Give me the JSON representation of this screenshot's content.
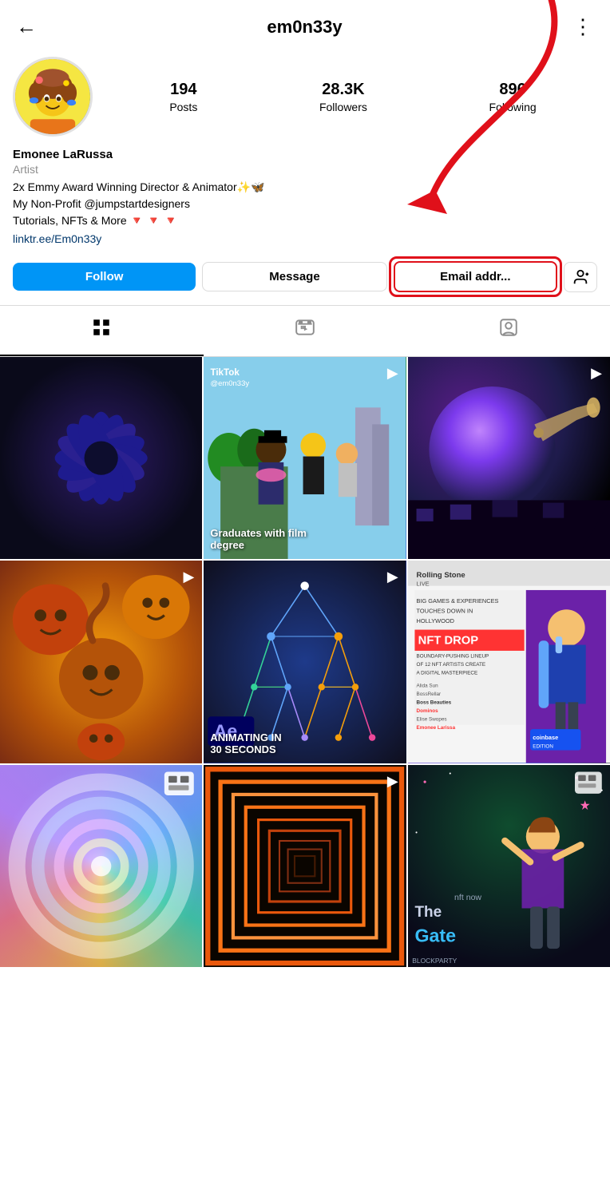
{
  "header": {
    "back_icon": "←",
    "username": "em0n33y",
    "more_icon": "⋮"
  },
  "profile": {
    "stats": {
      "posts_count": "194",
      "posts_label": "Posts",
      "followers_count": "28.3K",
      "followers_label": "Followers",
      "following_count": "896",
      "following_label": "Following"
    },
    "name": "Emonee LaRussa",
    "category": "Artist",
    "bio_line1": "2x Emmy Award Winning Director & Animator✨🦋",
    "bio_line2": "My Non-Profit @jumpstartdesigners",
    "bio_line3": "Tutorials, NFTs & More 🔻 🔻 🔻",
    "link": "linktr.ee/Em0n33y"
  },
  "buttons": {
    "follow": "Follow",
    "message": "Message",
    "email": "Email addr...",
    "person_icon": "👤"
  },
  "tabs": {
    "grid_icon": "▦",
    "reels_icon": "📺",
    "tagged_icon": "🏷"
  },
  "grid_items": [
    {
      "id": 1,
      "has_play": false,
      "label": "",
      "bg": "grid-bg-1"
    },
    {
      "id": 2,
      "has_play": true,
      "label": "Graduates with film degree",
      "bg": "grid-bg-2",
      "tiktok": true
    },
    {
      "id": 3,
      "has_play": true,
      "label": "",
      "bg": "grid-bg-3"
    },
    {
      "id": 4,
      "has_play": true,
      "label": "",
      "bg": "grid-bg-4"
    },
    {
      "id": 5,
      "has_play": true,
      "label": "ANIMATING IN 30 SECONDS",
      "bg": "grid-bg-5",
      "ae": true
    },
    {
      "id": 6,
      "has_play": false,
      "label": "",
      "bg": "grid-bg-6",
      "magazine": true
    },
    {
      "id": 7,
      "has_play": false,
      "label": "",
      "bg": "grid-bg-7",
      "corner": true
    },
    {
      "id": 8,
      "has_play": true,
      "label": "",
      "bg": "grid-bg-8"
    },
    {
      "id": 9,
      "has_play": false,
      "label": "The Gate",
      "bg": "grid-bg-9",
      "corner": true
    }
  ]
}
